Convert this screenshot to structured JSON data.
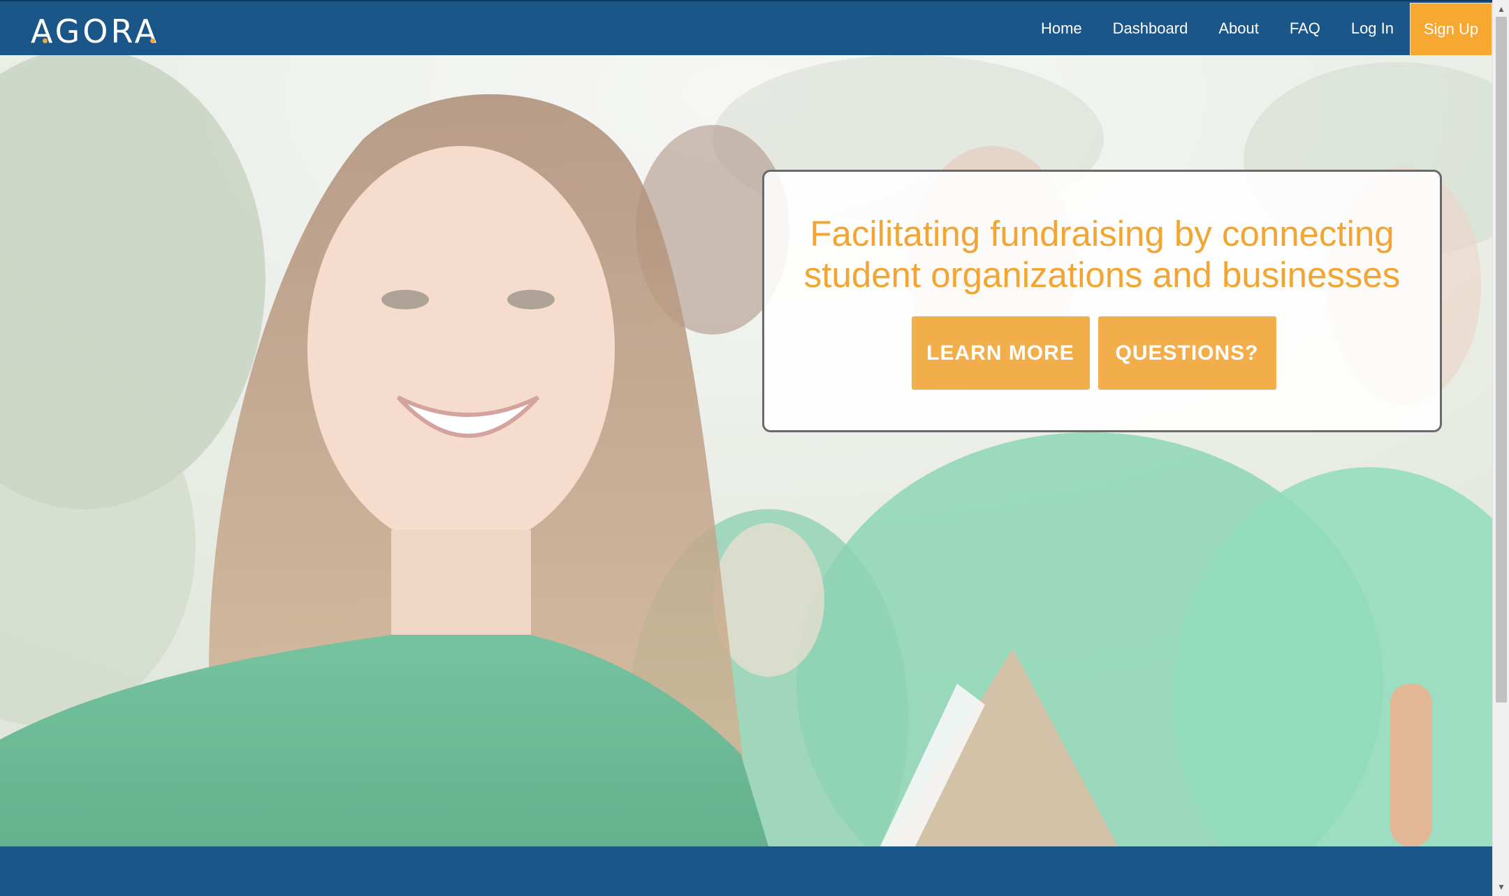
{
  "brand": {
    "logo_text": "AGORA",
    "colors": {
      "navy": "#1b5688",
      "orange": "#f6a831",
      "headline_orange": "#f2a533"
    }
  },
  "nav": {
    "items": [
      {
        "label": "Home"
      },
      {
        "label": "Dashboard"
      },
      {
        "label": "About"
      },
      {
        "label": "FAQ"
      },
      {
        "label": "Log In"
      }
    ],
    "signup_label": "Sign Up"
  },
  "hero": {
    "headline_line1": "Facilitating fundraising by connecting",
    "headline_line2": "student organizations and businesses",
    "buttons": {
      "learn_more": "LEARN MORE",
      "questions": "QUESTIONS?"
    },
    "image": "smiling student volunteers in green t-shirts holding a clipboard"
  },
  "scrollbar": {
    "up_icon": "scroll-up-arrow-icon",
    "down_icon": "scroll-down-arrow-icon"
  }
}
